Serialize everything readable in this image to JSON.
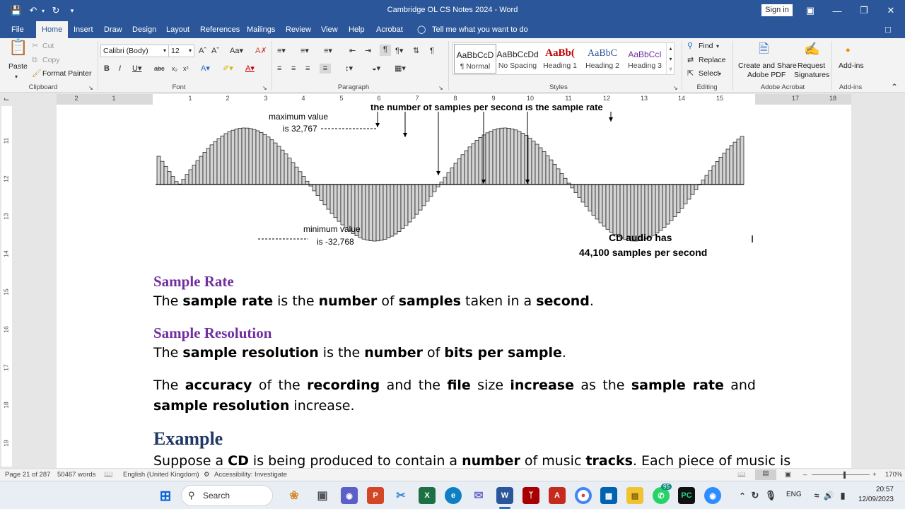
{
  "titlebar": {
    "title": "Cambridge OL CS Notes 2024  -  Word",
    "signin": "Sign in"
  },
  "tabs": [
    "File",
    "Home",
    "Insert",
    "Draw",
    "Design",
    "Layout",
    "References",
    "Mailings",
    "Review",
    "View",
    "Help",
    "Acrobat"
  ],
  "tell_me": "Tell me what you want to do",
  "clipboard": {
    "paste": "Paste",
    "cut": "Cut",
    "copy": "Copy",
    "format_painter": "Format Painter",
    "label": "Clipboard"
  },
  "font": {
    "name": "Calibri (Body)",
    "size": "12",
    "label": "Font"
  },
  "paragraph": {
    "label": "Paragraph"
  },
  "styles": {
    "items": [
      {
        "sample": "AaBbCcD",
        "name": "¶ Normal"
      },
      {
        "sample": "AaBbCcDd",
        "name": "No Spacing"
      },
      {
        "sample": "AaBb(",
        "name": "Heading 1"
      },
      {
        "sample": "AaBbC",
        "name": "Heading 2"
      },
      {
        "sample": "AaBbCcI",
        "name": "Heading 3"
      }
    ],
    "label": "Styles"
  },
  "editing": {
    "find": "Find",
    "replace": "Replace",
    "select": "Select",
    "label": "Editing"
  },
  "acrobat": {
    "create": "Create and Share",
    "create2": "Adobe PDF",
    "request": "Request",
    "request2": "Signatures",
    "label": "Adobe Acrobat"
  },
  "addins": {
    "button": "Add-ins",
    "label": "Add-ins"
  },
  "ruler": {
    "h": [
      "2",
      "1",
      "1",
      "2",
      "3",
      "4",
      "5",
      "6",
      "7",
      "8",
      "9",
      "10",
      "11",
      "12",
      "13",
      "14",
      "15",
      "17",
      "18"
    ],
    "v": [
      "11",
      "12",
      "13",
      "14",
      "15",
      "16",
      "17",
      "18",
      "19"
    ]
  },
  "figure": {
    "top_caption": "the number of samples per second is the  sample rate",
    "max_label1": "maximum value",
    "max_label2": "is 32,767",
    "min_label1": "minimum value",
    "min_label2": "is -32,768",
    "cd_label1": "CD audio has",
    "cd_label2": "44,100 samples per second"
  },
  "doc": {
    "h_sample_rate": "Sample Rate",
    "p1": {
      "a": "The ",
      "b": "sample rate",
      "c": " is the ",
      "d": "number",
      "e": " of ",
      "f": "samples",
      "g": " taken in a ",
      "h": "second",
      "i": "."
    },
    "h_sample_res": "Sample Resolution",
    "p2": {
      "a": "The ",
      "b": "sample resolution",
      "c": " is the ",
      "d": "number",
      "e": " of ",
      "f": "bits per sample",
      "g": "."
    },
    "p3": {
      "a": "The ",
      "b": "accuracy",
      "c": " of the ",
      "d": "recording",
      "e": " and the ",
      "f": "file",
      "g": " size ",
      "h": "increase",
      "i": " as the ",
      "j": "sample rate",
      "k": " and ",
      "l": "sample resolution",
      "m": " increase."
    },
    "h_example": "Example",
    "p4": {
      "a": "Suppose a ",
      "b": "CD",
      "c": " is being produced to contain a ",
      "d": "number",
      "e": " of music ",
      "f": "tracks",
      "g": ". Each piece of music is"
    }
  },
  "status": {
    "page": "Page 21 of 287",
    "words": "50467 words",
    "lang": "English (United Kingdom)",
    "access": "Accessibility: Investigate",
    "zoom": "170%"
  },
  "taskbar": {
    "search": "Search",
    "badge": "95",
    "lang": "ENG",
    "time": "20:57",
    "date": "12/09/2023"
  }
}
